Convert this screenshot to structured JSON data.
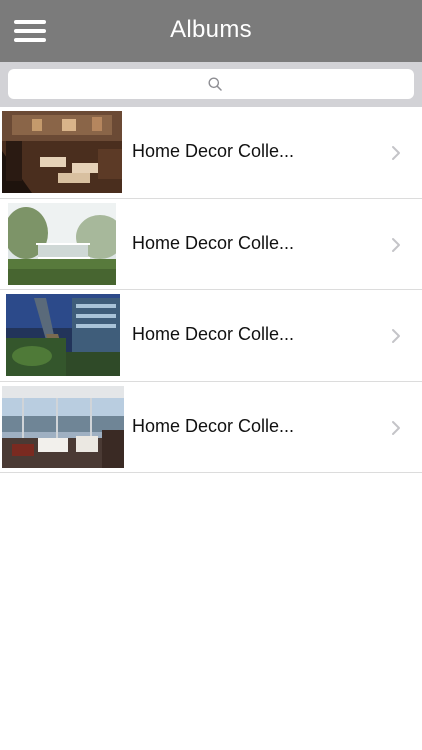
{
  "header": {
    "title": "Albums",
    "menu_icon": "hamburger-menu-icon"
  },
  "search": {
    "icon": "search-icon",
    "placeholder": ""
  },
  "albums": [
    {
      "label": "Home Decor Colle...",
      "thumbnail": "loft-interior-wood"
    },
    {
      "label": "Home Decor Colle...",
      "thumbnail": "glass-house-lawn"
    },
    {
      "label": "Home Decor Colle...",
      "thumbnail": "modern-building-night"
    },
    {
      "label": "Home Decor Colle...",
      "thumbnail": "living-room-view"
    }
  ],
  "colors": {
    "navbar": "#7b7b7b",
    "searchbar": "#d2d2d6",
    "chevron": "#c4c4c8"
  }
}
